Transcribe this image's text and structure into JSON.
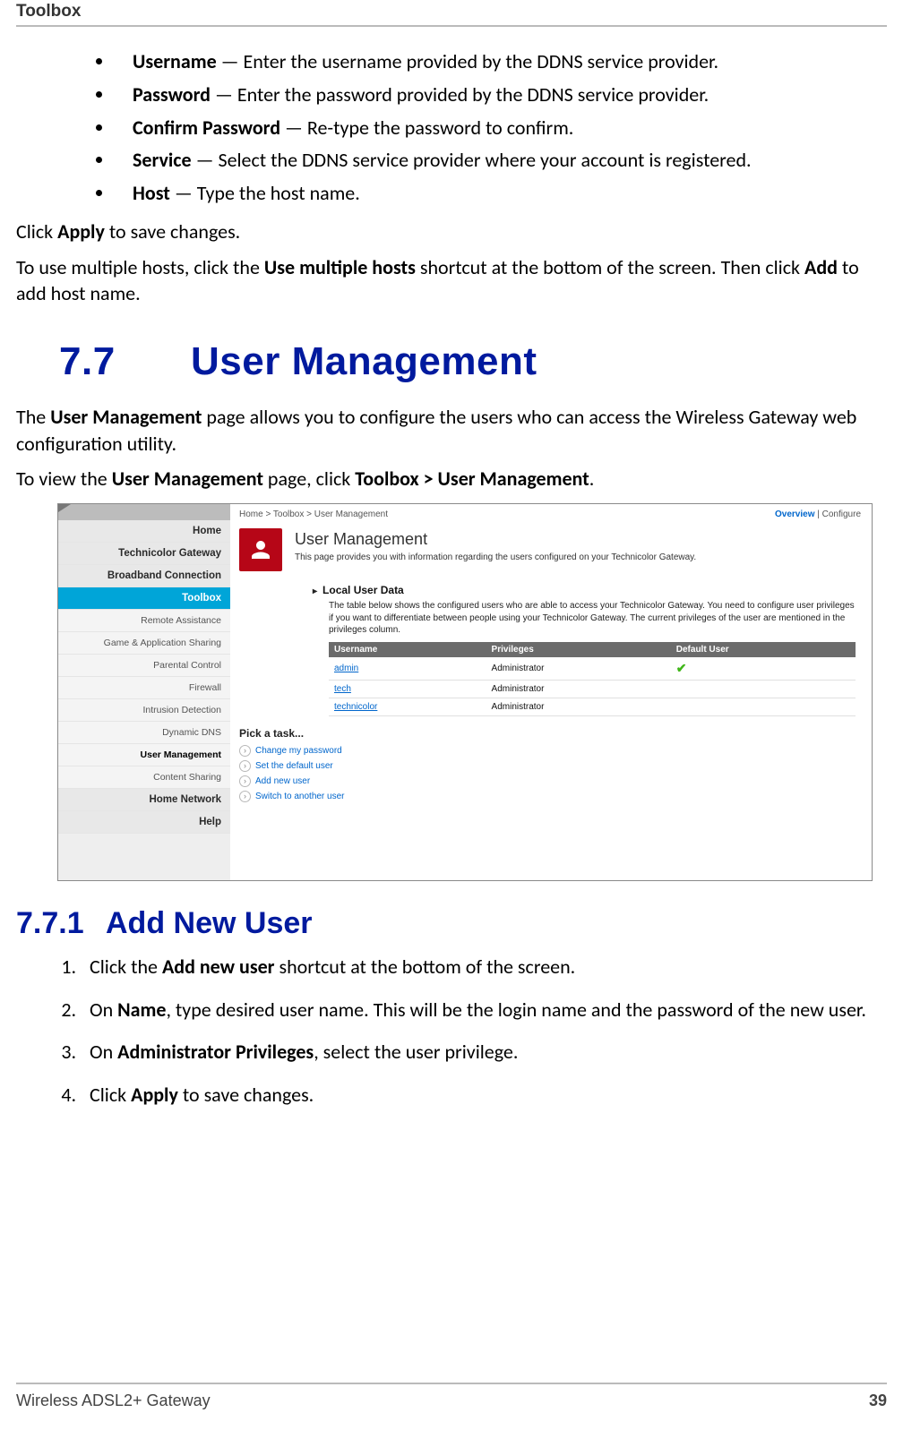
{
  "header": {
    "title": "Toolbox"
  },
  "bullets": [
    {
      "term": "Username",
      "desc": " — Enter the username provided by the DDNS service provider."
    },
    {
      "term": "Password",
      "desc": " — Enter the password provided by the DDNS service provider."
    },
    {
      "term": "Confirm Password",
      "desc": " — Re-type the password to confirm."
    },
    {
      "term": "Service",
      "desc": " — Select the DDNS service provider where your account is registered."
    },
    {
      "term": "Host",
      "desc": " — Type the host name."
    }
  ],
  "body": {
    "apply_line_pre": "Click ",
    "apply_term": "Apply",
    "apply_line_post": " to save changes.",
    "multi_pre": "To use multiple hosts, click the ",
    "multi_term1": "Use multiple hosts",
    "multi_mid": " shortcut at the bottom of the screen. Then click ",
    "multi_term2": "Add",
    "multi_post": " to add host name."
  },
  "section": {
    "number": "7.7",
    "title": "User Management"
  },
  "intro1_pre": "The ",
  "intro1_term": "User Management",
  "intro1_post": " page allows you to configure the users who can access the Wireless Gateway web configuration utility.",
  "intro2_pre": "To view the ",
  "intro2_term": "User Management",
  "intro2_mid": " page, click ",
  "intro2_term2": "Toolbox > User Management",
  "intro2_post": ".",
  "shot": {
    "breadcrumb": "Home > Toolbox > User Management",
    "ov": "Overview",
    "ov_sep": " | ",
    "cfg": "Configure",
    "nav": {
      "home": "Home",
      "gateway": "Technicolor Gateway",
      "broadband": "Broadband Connection",
      "toolbox": "Toolbox",
      "items": [
        "Remote Assistance",
        "Game & Application Sharing",
        "Parental Control",
        "Firewall",
        "Intrusion Detection",
        "Dynamic DNS",
        "User Management",
        "Content Sharing"
      ],
      "home_net": "Home Network",
      "help": "Help"
    },
    "main": {
      "title": "User Management",
      "subtitle": "This page provides you with information regarding the users configured on your Technicolor Gateway.",
      "section_label": "Local User Data",
      "section_desc": "The table below shows the configured users who are able to access your Technicolor Gateway. You need to configure user privileges if you want to differentiate between people using your Technicolor Gateway. The current privileges of the user are mentioned in the privileges column.",
      "table": {
        "headers": [
          "Username",
          "Privileges",
          "Default User"
        ],
        "rows": [
          {
            "u": "admin",
            "p": "Administrator",
            "d": true
          },
          {
            "u": "tech",
            "p": "Administrator",
            "d": false
          },
          {
            "u": "technicolor",
            "p": "Administrator",
            "d": false
          }
        ]
      },
      "tasks_title": "Pick a task...",
      "tasks": [
        "Change my password",
        "Set the default user",
        "Add new user",
        "Switch to another user"
      ]
    }
  },
  "sub_section": {
    "number": "7.7.1",
    "title": "Add New User"
  },
  "steps": {
    "s1_pre": "Click the ",
    "s1_term": "Add new user",
    "s1_post": " shortcut at the bottom of the screen.",
    "s2_pre": "On ",
    "s2_term": "Name",
    "s2_post": ", type desired user name. This will be the login name and the password of the new user.",
    "s3_pre": "On ",
    "s3_term": "Administrator Privileges",
    "s3_post": ", select the user privilege.",
    "s4_pre": "Click ",
    "s4_term": "Apply",
    "s4_post": " to save changes."
  },
  "footer": {
    "product": "Wireless ADSL2+ Gateway",
    "page": "39"
  }
}
